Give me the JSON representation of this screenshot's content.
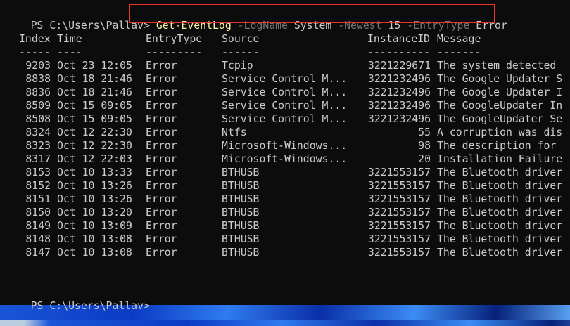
{
  "prompt": "PS C:\\Users\\Pallav>",
  "command": {
    "cmdlet": "Get-EventLog",
    "args": [
      {
        "param": "-LogName",
        "value": "System"
      },
      {
        "param": "-Newest",
        "value": "15"
      },
      {
        "param": "-EntryType",
        "value": "Error"
      }
    ]
  },
  "table": {
    "headers": [
      "Index",
      "Time",
      "EntryType",
      "Source",
      "InstanceID",
      "Message"
    ],
    "underlines": [
      "-----",
      "----",
      "---------",
      "------",
      "----------",
      "-------"
    ],
    "rows": [
      [
        "9203",
        "Oct 23 12:05",
        "Error",
        "Tcpip",
        "3221229671",
        "The system detected"
      ],
      [
        "8838",
        "Oct 18 21:46",
        "Error",
        "Service Control M...",
        "3221232496",
        "The Google Updater S"
      ],
      [
        "8836",
        "Oct 18 21:46",
        "Error",
        "Service Control M...",
        "3221232496",
        "The Google Updater I"
      ],
      [
        "8509",
        "Oct 15 09:05",
        "Error",
        "Service Control M...",
        "3221232496",
        "The GoogleUpdater In"
      ],
      [
        "8508",
        "Oct 15 09:05",
        "Error",
        "Service Control M...",
        "3221232496",
        "The GoogleUpdater Se"
      ],
      [
        "8324",
        "Oct 12 22:30",
        "Error",
        "Ntfs",
        "55",
        "A corruption was dis"
      ],
      [
        "8323",
        "Oct 12 22:30",
        "Error",
        "Microsoft-Windows...",
        "98",
        "The description for"
      ],
      [
        "8317",
        "Oct 12 22:03",
        "Error",
        "Microsoft-Windows...",
        "20",
        "Installation Failure"
      ],
      [
        "8153",
        "Oct 10 13:33",
        "Error",
        "BTHUSB",
        "3221553157",
        "The Bluetooth driver"
      ],
      [
        "8152",
        "Oct 10 13:26",
        "Error",
        "BTHUSB",
        "3221553157",
        "The Bluetooth driver"
      ],
      [
        "8151",
        "Oct 10 13:26",
        "Error",
        "BTHUSB",
        "3221553157",
        "The Bluetooth driver"
      ],
      [
        "8150",
        "Oct 10 13:20",
        "Error",
        "BTHUSB",
        "3221553157",
        "The Bluetooth driver"
      ],
      [
        "8149",
        "Oct 10 13:09",
        "Error",
        "BTHUSB",
        "3221553157",
        "The Bluetooth driver"
      ],
      [
        "8148",
        "Oct 10 13:08",
        "Error",
        "BTHUSB",
        "3221553157",
        "The Bluetooth driver"
      ],
      [
        "8147",
        "Oct 10 13:08",
        "Error",
        "BTHUSB",
        "3221553157",
        "The Bluetooth driver"
      ]
    ]
  }
}
